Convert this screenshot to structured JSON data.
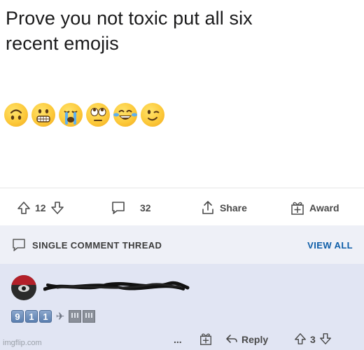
{
  "post": {
    "title_line1": "Prove you not toxic put all six",
    "title_line2": "recent emojis",
    "emojis": [
      "upside-down-face",
      "grimacing-face",
      "loudly-crying-face",
      "face-with-rolling-eyes",
      "face-with-tears-of-joy",
      "winking-face"
    ]
  },
  "actions": {
    "upvotes": "12",
    "comments": "32",
    "share_label": "Share",
    "award_label": "Award"
  },
  "thread": {
    "label": "SINGLE COMMENT THREAD",
    "view_all": "VIEW ALL"
  },
  "comment": {
    "body_keys": [
      "9",
      "1",
      "1"
    ],
    "more": "...",
    "reply_label": "Reply",
    "score": "3"
  },
  "watermark": "imgflip.com",
  "colors": {
    "thread_bg": "#eef0f7",
    "comment_bg": "#e1e5f3",
    "link": "#0e5ea8"
  }
}
